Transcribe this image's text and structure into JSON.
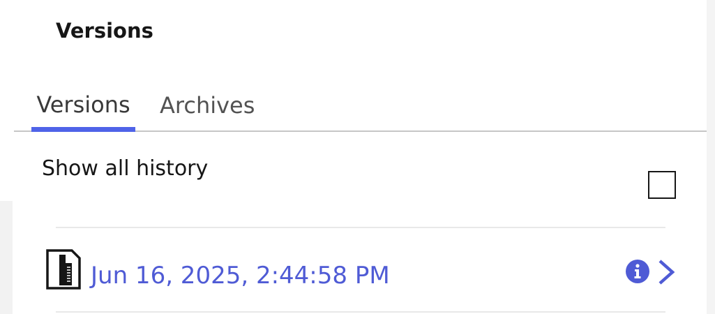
{
  "panel": {
    "title": "Versions"
  },
  "tabs": [
    {
      "label": "Versions",
      "selected": true
    },
    {
      "label": "Archives",
      "selected": false
    }
  ],
  "history": {
    "label": "Show all history",
    "checked": false
  },
  "versions": [
    {
      "date": "Jun 16, 2025, 2:44:58 PM",
      "icon": "document-icon"
    }
  ],
  "colors": {
    "accent": "#4f63e8",
    "link": "#4f5bd5",
    "text": "#161616",
    "divider": "#c6c6c6"
  }
}
